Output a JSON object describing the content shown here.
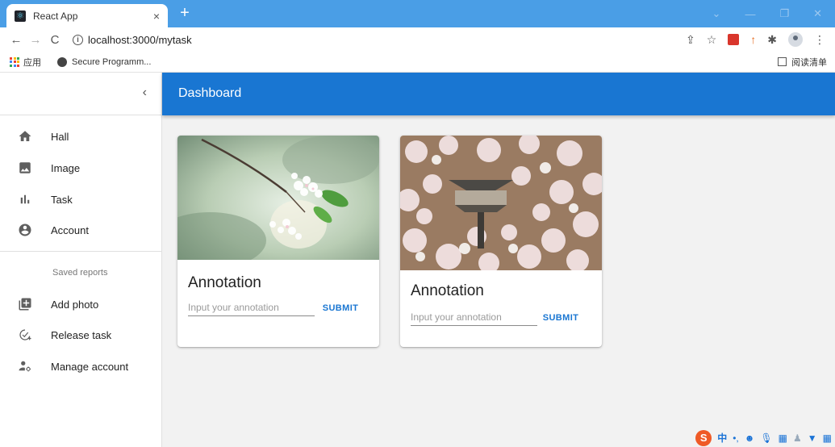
{
  "browser": {
    "tab_title": "React App",
    "tab_close": "×",
    "new_tab": "+",
    "url": "localhost:3000/mytask",
    "bookmarks": {
      "apps_label": "应用",
      "secure_label": "Secure Programm..."
    },
    "reading_list": "阅读清单",
    "window_controls": [
      "⌄",
      "—",
      "❐",
      "✕"
    ]
  },
  "sidebar": {
    "collapse_icon": "‹",
    "primary": [
      {
        "label": "Hall",
        "icon": "home-icon"
      },
      {
        "label": "Image",
        "icon": "image-icon"
      },
      {
        "label": "Task",
        "icon": "bar-chart-icon"
      },
      {
        "label": "Account",
        "icon": "account-circle-icon"
      }
    ],
    "subheader": "Saved reports",
    "secondary": [
      {
        "label": "Add photo",
        "icon": "add-photo-icon"
      },
      {
        "label": "Release task",
        "icon": "release-task-icon"
      },
      {
        "label": "Manage account",
        "icon": "manage-account-icon"
      }
    ]
  },
  "appbar": {
    "title": "Dashboard",
    "color": "#1976d2"
  },
  "cards": [
    {
      "image": "cherry-blossom-branch-image",
      "heading": "Annotation",
      "placeholder": "Input your annotation",
      "value": "",
      "submit": "SUBMIT"
    },
    {
      "image": "cherry-blossom-lamp-image",
      "heading": "Annotation",
      "placeholder": "Input your annotation",
      "value": "",
      "submit": "SUBMIT"
    }
  ],
  "tray": {
    "ime": "S",
    "ime_mode": "中",
    "ime_punct": "•,"
  }
}
